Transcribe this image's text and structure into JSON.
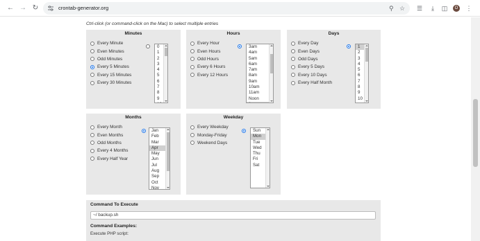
{
  "browser": {
    "url": "crontab-generator.org",
    "profile_initial": "O"
  },
  "page": {
    "hint": "Ctrl-click (or command-click on the Mac) to select multiple entries"
  },
  "minutes": {
    "title": "Minutes",
    "options": [
      "Every Minute",
      "Even Minutes",
      "Odd Minutes",
      "Every 5 Minutes",
      "Every 15 Minutes",
      "Every 30 Minutes"
    ],
    "checked_index": 3,
    "list": [
      "0",
      "1",
      "2",
      "3",
      "4",
      "5",
      "6",
      "7",
      "8",
      "9",
      "10"
    ],
    "list_selected": []
  },
  "hours": {
    "title": "Hours",
    "options": [
      "Every Hour",
      "Even Hours",
      "Odd Hours",
      "Every 6 Hours",
      "Every 12 Hours"
    ],
    "checked_index": -1,
    "list": [
      "3am",
      "4am",
      "5am",
      "6am",
      "7am",
      "8am",
      "9am",
      "10am",
      "11am",
      "Noon",
      "1pm"
    ],
    "list_selected": [
      "1pm"
    ]
  },
  "days": {
    "title": "Days",
    "options": [
      "Every Day",
      "Even Days",
      "Odd Days",
      "Every 5 Days",
      "Every 10 Days",
      "Every Half Month"
    ],
    "checked_index": -1,
    "list": [
      "1",
      "2",
      "3",
      "4",
      "5",
      "6",
      "7",
      "8",
      "9",
      "10"
    ],
    "list_selected": [
      "1"
    ]
  },
  "months": {
    "title": "Months",
    "options": [
      "Every Month",
      "Even Months",
      "Odd Months",
      "Every 4 Months",
      "Every Half Year"
    ],
    "checked_index": -1,
    "list": [
      "Jan",
      "Feb",
      "Mar",
      "Apr",
      "May",
      "Jun",
      "Jul",
      "Aug",
      "Sep",
      "Oct",
      "Nov"
    ],
    "list_selected": [
      "Apr"
    ]
  },
  "weekday": {
    "title": "Weekday",
    "options": [
      "Every Weekday",
      "Monday-Friday",
      "Weekend Days"
    ],
    "checked_index": -1,
    "list": [
      "Sun",
      "Mon",
      "Tue",
      "Wed",
      "Thu",
      "Fri",
      "Sat"
    ],
    "list_selected": [
      "Mon"
    ]
  },
  "command": {
    "title": "Command To Execute",
    "value": "~/ backup.sh",
    "examples_title": "Command Examples:",
    "examples_sub": "Execute PHP script:"
  },
  "colors": {
    "panel_bg": "#e8e8e8",
    "accent": "#1a73e8",
    "selected_item": "#cfcfcf"
  }
}
